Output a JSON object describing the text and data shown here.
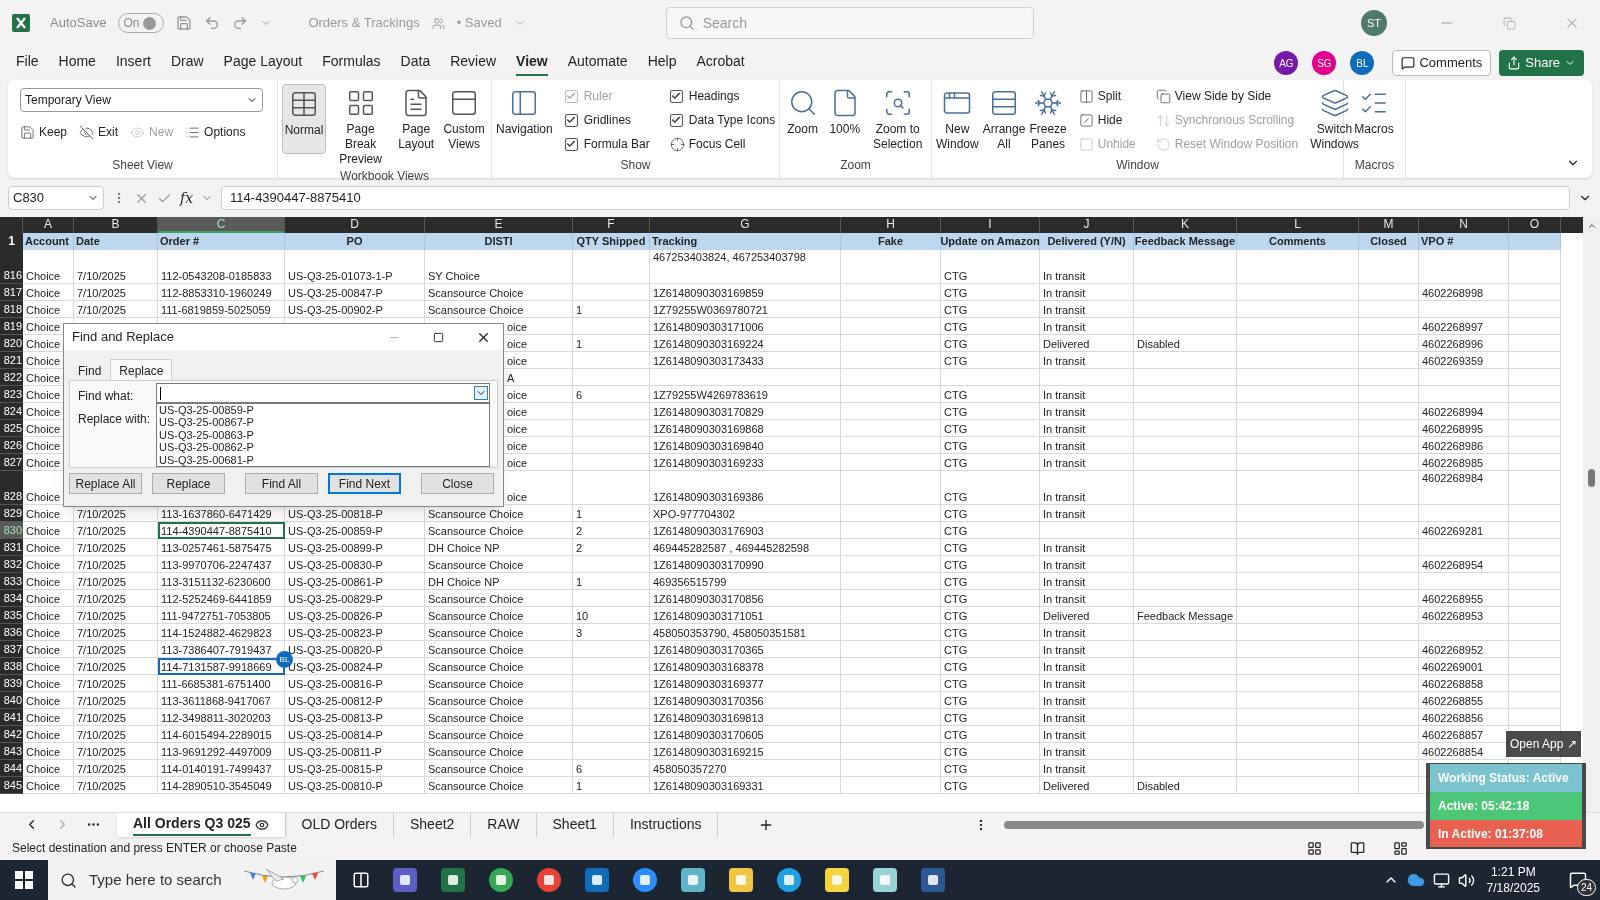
{
  "title_bar": {
    "autosave": "AutoSave",
    "autosave_toggle": "On",
    "autosave_on": true,
    "file_name": "Orders & Trackings",
    "save_state": "• Saved",
    "search_placeholder": "Search",
    "user": "ST"
  },
  "menu": [
    {
      "label": "File",
      "selected": false
    },
    {
      "label": "Home",
      "selected": false
    },
    {
      "label": "Insert",
      "selected": false
    },
    {
      "label": "Draw",
      "selected": false
    },
    {
      "label": "Page Layout",
      "selected": false
    },
    {
      "label": "Formulas",
      "selected": false
    },
    {
      "label": "Data",
      "selected": false
    },
    {
      "label": "Review",
      "selected": false
    },
    {
      "label": "View",
      "selected": true
    },
    {
      "label": "Automate",
      "selected": false
    },
    {
      "label": "Help",
      "selected": false
    },
    {
      "label": "Acrobat",
      "selected": false
    }
  ],
  "collaborators": [
    {
      "initials": "AG",
      "color": "#7719aa"
    },
    {
      "initials": "SG",
      "color": "#e3008c"
    },
    {
      "initials": "BL",
      "color": "#0f6cbd"
    }
  ],
  "comments_button": "Comments",
  "share_button": "Share",
  "ribbon": [
    {
      "name": "Sheet View",
      "view_select": "Temporary View",
      "items": [
        {
          "label": "Keep",
          "disabled": false
        },
        {
          "label": "Exit",
          "disabled": false
        },
        {
          "label": "New",
          "disabled": true
        },
        {
          "label": "Options",
          "disabled": false
        }
      ]
    },
    {
      "name": "Workbook Views",
      "items": [
        {
          "label": "Normal",
          "selected": true
        },
        {
          "label": "Page Break Preview",
          "selected": false
        },
        {
          "label": "Page Layout",
          "selected": false
        },
        {
          "label": "Custom Views",
          "selected": false
        }
      ]
    },
    {
      "name": "Show",
      "items": [
        {
          "kind": "large",
          "label": "Navigation",
          "disabled": false
        },
        {
          "kind": "check",
          "label": "Ruler",
          "checked": true,
          "disabled": true
        },
        {
          "kind": "check",
          "label": "Gridlines",
          "checked": true,
          "disabled": false
        },
        {
          "kind": "check",
          "label": "Formula Bar",
          "checked": true,
          "disabled": false
        },
        {
          "kind": "check",
          "label": "Headings",
          "checked": true,
          "disabled": false
        },
        {
          "kind": "check",
          "label": "Data Type Icons",
          "checked": true,
          "disabled": false
        },
        {
          "kind": "small",
          "label": "Focus Cell",
          "disabled": false
        }
      ]
    },
    {
      "name": "Zoom",
      "items": [
        {
          "kind": "large",
          "label": "Zoom",
          "disabled": false
        },
        {
          "kind": "large",
          "label": "100%",
          "disabled": false
        },
        {
          "kind": "large",
          "label": "Zoom to Selection",
          "disabled": false
        }
      ]
    },
    {
      "name": "Window",
      "items": [
        {
          "kind": "large",
          "label": "New Window",
          "disabled": false
        },
        {
          "kind": "large",
          "label": "Arrange All",
          "disabled": false
        },
        {
          "kind": "large",
          "label": "Freeze Panes",
          "disabled": false
        },
        {
          "kind": "small",
          "label": "Split",
          "disabled": false
        },
        {
          "kind": "small",
          "label": "Hide",
          "disabled": false
        },
        {
          "kind": "small",
          "label": "Unhide",
          "disabled": true
        },
        {
          "kind": "small",
          "label": "View Side by Side",
          "disabled": false
        },
        {
          "kind": "small",
          "label": "Synchronous Scrolling",
          "disabled": true
        },
        {
          "kind": "small",
          "label": "Reset Window Position",
          "disabled": true
        },
        {
          "kind": "large",
          "label": "Switch Windows",
          "disabled": false
        }
      ]
    },
    {
      "name": "Macros",
      "items": [
        {
          "kind": "large",
          "label": "Macros",
          "disabled": false
        }
      ]
    }
  ],
  "formula_bar": {
    "name_box": "C830",
    "function_label": "fx",
    "value": "114-4390447-8875410"
  },
  "columns": [
    {
      "letter": "A",
      "heading": "Account",
      "selected": false
    },
    {
      "letter": "B",
      "heading": "Date",
      "selected": false
    },
    {
      "letter": "C",
      "heading": "Order #",
      "selected": true
    },
    {
      "letter": "D",
      "heading": "PO",
      "selected": false
    },
    {
      "letter": "E",
      "heading": "DISTI",
      "selected": false
    },
    {
      "letter": "F",
      "heading": "QTY Shipped",
      "selected": false
    },
    {
      "letter": "G",
      "heading": "Tracking",
      "selected": false
    },
    {
      "letter": "H",
      "heading": "Fake",
      "selected": false
    },
    {
      "letter": "I",
      "heading": "Update on Amazon",
      "selected": false
    },
    {
      "letter": "J",
      "heading": "Delivered (Y/N)",
      "selected": false
    },
    {
      "letter": "K",
      "heading": "Feedback Message",
      "selected": false
    },
    {
      "letter": "L",
      "heading": "Comments",
      "selected": false
    },
    {
      "letter": "M",
      "heading": "Closed",
      "selected": false
    },
    {
      "letter": "N",
      "heading": "VPO #",
      "selected": false
    },
    {
      "letter": "O",
      "selected": false
    }
  ],
  "header_row": "1",
  "rows": [
    {
      "num": "816",
      "selected": false,
      "cells": {
        "A": "Choice",
        "B": "7/10/2025",
        "C": "112-0543208-0185833",
        "D": "US-Q3-25-01073-1-P",
        "E": "SY Choice",
        "G": {
          "text": "467253403824, 467253403798",
          "wrapped": true
        },
        "I": "CTG",
        "J": "In transit"
      }
    },
    {
      "num": "817",
      "selected": false,
      "cells": {
        "A": "Choice",
        "B": "7/10/2025",
        "C": "112-8853310-1960249",
        "D": "US-Q3-25-00847-P",
        "E": "Scansource Choice",
        "G": "1Z6148090303169859",
        "I": "CTG",
        "J": "In transit",
        "N": "4602268998"
      }
    },
    {
      "num": "818",
      "selected": false,
      "cells": {
        "A": "Choice",
        "B": "7/10/2025",
        "C": "111-6819859-5025059",
        "D": "US-Q3-25-00902-P",
        "E": "Scansource Choice",
        "F": "1",
        "G": "1Z79255W0369780721",
        "I": "CTG",
        "J": "In transit"
      }
    },
    {
      "num": "819",
      "selected": false,
      "cells": {
        "A": "Choice",
        "E": {
          "text": "oice",
          "cut": true
        },
        "G": "1Z6148090303171006",
        "I": "CTG",
        "J": "In transit",
        "N": "4602268997"
      }
    },
    {
      "num": "820",
      "selected": false,
      "cells": {
        "A": "Choice",
        "E": {
          "text": "oice",
          "cut": true
        },
        "F": "1",
        "G": "1Z6148090303169224",
        "I": "CTG",
        "J": "Delivered",
        "K": "Disabled",
        "N": "4602268996"
      }
    },
    {
      "num": "821",
      "selected": false,
      "cells": {
        "A": "Choice",
        "E": {
          "text": "oice",
          "cut": true
        },
        "G": "1Z6148090303173433",
        "I": "CTG",
        "J": "In transit",
        "N": "4602269359"
      }
    },
    {
      "num": "822",
      "selected": false,
      "cells": {
        "A": "Choice",
        "E": {
          "text": "A",
          "cut": true
        }
      }
    },
    {
      "num": "823",
      "selected": false,
      "cells": {
        "A": "Choice",
        "E": {
          "text": "oice",
          "cut": true
        },
        "F": "6",
        "G": "1Z79255W4269783619",
        "I": "CTG",
        "J": "In transit"
      }
    },
    {
      "num": "824",
      "selected": false,
      "cells": {
        "A": "Choice",
        "E": {
          "text": "oice",
          "cut": true
        },
        "G": "1Z6148090303170829",
        "I": "CTG",
        "J": "In transit",
        "N": "4602268994"
      }
    },
    {
      "num": "825",
      "selected": false,
      "cells": {
        "A": "Choice",
        "E": {
          "text": "oice",
          "cut": true
        },
        "G": "1Z6148090303169868",
        "I": "CTG",
        "J": "In transit",
        "N": "4602268995"
      }
    },
    {
      "num": "826",
      "selected": false,
      "cells": {
        "A": "Choice",
        "E": {
          "text": "oice",
          "cut": true
        },
        "G": "1Z6148090303169840",
        "I": "CTG",
        "J": "In transit",
        "N": "4602268986"
      }
    },
    {
      "num": "827",
      "selected": false,
      "cells": {
        "A": "Choice",
        "E": {
          "text": "oice",
          "cut": true
        },
        "G": "1Z6148090303169233",
        "I": "CTG",
        "J": "In transit",
        "N": "4602268985"
      }
    },
    {
      "num": "828",
      "selected": false,
      "cells": {
        "A": "Choice",
        "E": {
          "text": "oice",
          "cut": true
        },
        "G": "1Z6148090303169386",
        "I": "CTG",
        "J": "In transit",
        "N": {
          "text": "4602268984",
          "wrapped": true
        }
      }
    },
    {
      "num": "829",
      "selected": false,
      "cells": {
        "A": "Choice",
        "B": "7/10/2025",
        "C": "113-1637860-6471429",
        "D": "US-Q3-25-00818-P",
        "E": "Scansource Choice",
        "F": "1",
        "G": "XPO-977704302",
        "I": "CTG",
        "J": "In transit"
      }
    },
    {
      "num": "830",
      "selected": true,
      "cells": {
        "A": "Choice",
        "B": "7/10/2025",
        "C": {
          "text": "114-4390447-8875410",
          "active": true
        },
        "D": "US-Q3-25-00859-P",
        "E": "Scansource Choice",
        "F": "2",
        "G": "1Z6148090303176903",
        "I": "CTG",
        "N": "4602269281"
      }
    },
    {
      "num": "831",
      "selected": false,
      "cells": {
        "A": "Choice",
        "B": "7/10/2025",
        "C": "113-0257461-5875475",
        "D": "US-Q3-25-00899-P",
        "E": "DH Choice NP",
        "F": "2",
        "G": "469445282587 , 469445282598",
        "I": "CTG",
        "J": "In transit"
      }
    },
    {
      "num": "832",
      "selected": false,
      "cells": {
        "A": "Choice",
        "B": "7/10/2025",
        "C": "113-9970706-2247437",
        "D": "US-Q3-25-00830-P",
        "E": "Scansource Choice",
        "G": "1Z6148090303170990",
        "I": "CTG",
        "J": "In transit",
        "N": "4602268954"
      }
    },
    {
      "num": "833",
      "selected": false,
      "cells": {
        "A": "Choice",
        "B": "7/10/2025",
        "C": "113-3151132-6230600",
        "D": "US-Q3-25-00861-P",
        "E": "DH Choice NP",
        "F": "1",
        "G": "469356515799",
        "I": "CTG",
        "J": "In transit"
      }
    },
    {
      "num": "834",
      "selected": false,
      "cells": {
        "A": "Choice",
        "B": "7/10/2025",
        "C": "112-5252469-6441859",
        "D": "US-Q3-25-00829-P",
        "E": "Scansource Choice",
        "G": "1Z6148090303170856",
        "I": "CTG",
        "J": "In transit",
        "N": "4602268955"
      }
    },
    {
      "num": "835",
      "selected": false,
      "cells": {
        "A": "Choice",
        "B": "7/10/2025",
        "C": "111-9472751-7053805",
        "D": "US-Q3-25-00826-P",
        "E": "Scansource Choice",
        "F": "10",
        "G": "1Z6148090303171051",
        "I": "CTG",
        "J": "Delivered",
        "K": "Feedback Message",
        "N": "4602268953"
      }
    },
    {
      "num": "836",
      "selected": false,
      "cells": {
        "A": "Choice",
        "B": "7/10/2025",
        "C": "114-1524882-4629823",
        "D": "US-Q3-25-00823-P",
        "E": "Scansource Choice",
        "F": "3",
        "G": "458050353790, 458050351581",
        "I": "CTG",
        "J": "In transit"
      }
    },
    {
      "num": "837",
      "selected": false,
      "cells": {
        "A": "Choice",
        "B": "7/10/2025",
        "C": "113-7386407-7919437",
        "D": "US-Q3-25-00820-P",
        "E": "Scansource Choice",
        "G": "1Z6148090303170365",
        "I": "CTG",
        "J": "In transit",
        "N": "4602268952"
      }
    },
    {
      "num": "838",
      "selected": false,
      "cells": {
        "A": "Choice",
        "B": "7/10/2025",
        "C": {
          "text": "114-7131587-9918669",
          "collaborator": "BL",
          "color": "#0f6cbd"
        },
        "D": "US-Q3-25-00824-P",
        "E": "Scansource Choice",
        "G": "1Z6148090303168378",
        "I": "CTG",
        "J": "In transit",
        "N": "4602269001"
      }
    },
    {
      "num": "839",
      "selected": false,
      "cells": {
        "A": "Choice",
        "B": "7/10/2025",
        "C": "111-6685381-6751400",
        "D": "US-Q3-25-00816-P",
        "E": "Scansource Choice",
        "G": "1Z6148090303169377",
        "I": "CTG",
        "J": "In transit",
        "N": "4602268858"
      }
    },
    {
      "num": "840",
      "selected": false,
      "cells": {
        "A": "Choice",
        "B": "7/10/2025",
        "C": "113-3611868-9417067",
        "D": "US-Q3-25-00812-P",
        "E": "Scansource Choice",
        "G": "1Z6148090303170356",
        "I": "CTG",
        "J": "In transit",
        "N": "4602268855"
      }
    },
    {
      "num": "841",
      "selected": false,
      "cells": {
        "A": "Choice",
        "B": "7/10/2025",
        "C": "112-3498811-3020203",
        "D": "US-Q3-25-00813-P",
        "E": "Scansource Choice",
        "G": "1Z6148090303169813",
        "I": "CTG",
        "J": "In transit",
        "N": "4602268856"
      }
    },
    {
      "num": "842",
      "selected": false,
      "cells": {
        "A": "Choice",
        "B": "7/10/2025",
        "C": "114-6015494-2289015",
        "D": "US-Q3-25-00814-P",
        "E": "Scansource Choice",
        "G": "1Z6148090303170605",
        "I": "CTG",
        "J": "In transit",
        "N": "4602268857"
      }
    },
    {
      "num": "843",
      "selected": false,
      "cells": {
        "A": "Choice",
        "B": "7/10/2025",
        "C": "113-9691292-4497009",
        "D": "US-Q3-25-00811-P",
        "E": "Scansource Choice",
        "G": "1Z6148090303169215",
        "I": "CTG",
        "J": "In transit",
        "N": "4602268854"
      }
    },
    {
      "num": "844",
      "selected": false,
      "cells": {
        "A": "Choice",
        "B": "7/10/2025",
        "C": "114-0140191-7499437",
        "D": "US-Q3-25-00815-P",
        "E": "Scansource Choice",
        "F": "6",
        "G": "458050357270",
        "I": "CTG",
        "J": "In transit"
      }
    },
    {
      "num": "845",
      "selected": false,
      "cells": {
        "A": "Choice",
        "B": "7/10/2025",
        "C": "114-2890510-3545049",
        "D": "US-Q3-25-00810-P",
        "E": "Scansource Choice",
        "F": "1",
        "G": "1Z6148090303169331",
        "I": "CTG",
        "J": "Delivered",
        "K": "Disabled"
      }
    }
  ],
  "dialog": {
    "title": "Find and Replace",
    "tabs": [
      {
        "label": "Find",
        "selected": false
      },
      {
        "label": "Replace",
        "selected": true
      }
    ],
    "find_label": "Find what:",
    "replace_label": "Replace with:",
    "history": [
      "US-Q3-25-00859-P",
      "US-Q3-25-00867-P",
      "US-Q3-25-00863-P",
      "US-Q3-25-00862-P",
      "US-Q3-25-00681-P"
    ],
    "buttons": [
      {
        "label": "Replace All",
        "default": false
      },
      {
        "label": "Replace",
        "default": false
      },
      {
        "label": "Find All",
        "default": false
      },
      {
        "label": "Find Next",
        "default": true
      },
      {
        "label": "Close",
        "default": false
      }
    ]
  },
  "sheet_tabs": [
    {
      "label": "All Orders Q3 025",
      "selected": true,
      "view_icon": true
    },
    {
      "label": "OLD Orders",
      "selected": false,
      "view_icon": false
    },
    {
      "label": "Sheet2",
      "selected": false,
      "view_icon": false
    },
    {
      "label": "RAW",
      "selected": false,
      "view_icon": false
    },
    {
      "label": "Sheet1",
      "selected": false,
      "view_icon": false
    },
    {
      "label": "Instructions",
      "selected": false,
      "view_icon": false
    }
  ],
  "status_bar": "Select destination and press ENTER or choose Paste",
  "tracker": {
    "open_app": "Open App ↗",
    "status": "Working Status: Active",
    "active": "Active: 05:42:18",
    "inactive": "In Active: 01:37:08"
  },
  "taskbar": {
    "search_placeholder": "Type here to search",
    "time": "1:21 PM",
    "date": "7/18/2025",
    "notifications": "24"
  }
}
